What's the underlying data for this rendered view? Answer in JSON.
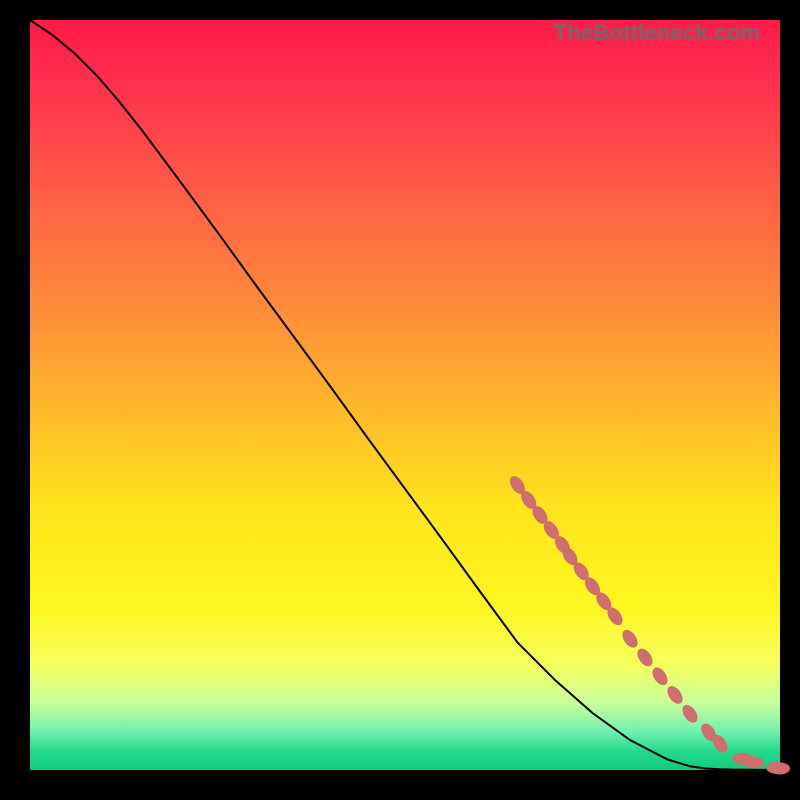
{
  "watermark": "TheBottleneck.com",
  "colors": {
    "marker": "#cf6e6e",
    "line": "#000000"
  },
  "chart_data": {
    "type": "line",
    "title": "",
    "xlabel": "",
    "ylabel": "",
    "xlim": [
      0,
      100
    ],
    "ylim": [
      0,
      100
    ],
    "grid": false,
    "series": [
      {
        "name": "curve",
        "x": [
          0,
          3,
          6,
          9,
          12,
          15,
          20,
          25,
          30,
          35,
          40,
          45,
          50,
          55,
          60,
          65,
          70,
          75,
          80,
          85,
          88,
          90,
          92,
          94,
          96,
          98,
          100
        ],
        "y": [
          100,
          98,
          95.5,
          92.5,
          89,
          85.2,
          78.5,
          71.7,
          64.8,
          58,
          51.2,
          44.3,
          37.5,
          30.7,
          23.8,
          17,
          12,
          7.6,
          4,
          1.4,
          0.5,
          0.2,
          0.1,
          0.05,
          0.03,
          0.02,
          0.02
        ],
        "style": "solid"
      }
    ],
    "markers": {
      "name": "highlighted-points",
      "x": [
        65,
        66.5,
        68,
        69.5,
        71,
        72,
        73.5,
        75,
        76.5,
        78,
        80,
        82,
        84,
        86,
        88,
        90.5,
        92,
        95,
        96.5,
        99.5,
        100
      ],
      "y": [
        38,
        36,
        34,
        32,
        30,
        28.5,
        26.5,
        24.5,
        22.5,
        20.5,
        17.5,
        15,
        12.5,
        10,
        7.5,
        5,
        3.5,
        1.5,
        1,
        0.3,
        0.2
      ]
    }
  }
}
